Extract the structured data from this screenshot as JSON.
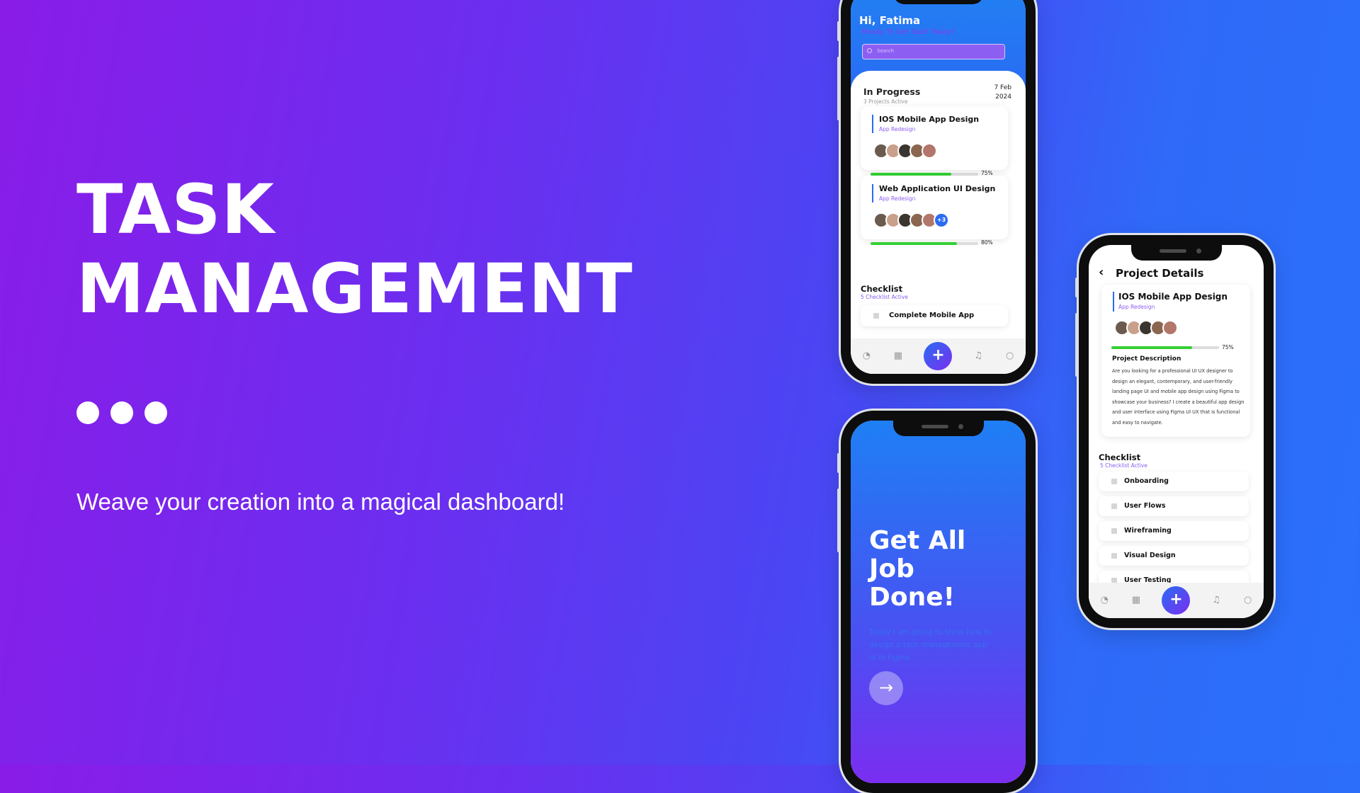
{
  "hero": {
    "title_line1": "TASK",
    "title_line2": "MANAGEMENT",
    "tagline": "Weave your creation into a magical dashboard!"
  },
  "colors": {
    "background_left": "#8a1ce8",
    "background_right": "#2a70fa",
    "accent_blue": "#2a6cf2",
    "accent_purple": "#8a5cf0",
    "progress_green": "#34d034"
  },
  "phone_home": {
    "greeting": "Hi, Fatima",
    "subtitle": "Ready To Get Start Today?",
    "search_placeholder": "Search",
    "section_title": "In Progress",
    "section_subtitle": "3 Projects Active",
    "date_line1": "7 Feb",
    "date_line2": "2024",
    "projects": [
      {
        "title": "IOS Mobile App Design",
        "subtitle": "App Redesign",
        "progress": 75,
        "progress_label": "75%",
        "extra_members": ""
      },
      {
        "title": "Web Application UI Design",
        "subtitle": "App Redesign",
        "progress": 80,
        "progress_label": "80%",
        "extra_members": "+3"
      }
    ],
    "checklist_title": "Checklist",
    "checklist_subtitle": "5 Checklist Active",
    "checklist_item": "Complete Mobile App",
    "nav": [
      "dashboard-icon",
      "calendar-icon",
      "add-icon",
      "bell-icon",
      "user-icon"
    ]
  },
  "phone_onboarding": {
    "headline_line1": "Get All",
    "headline_line2": "Job",
    "headline_line3": "Done!",
    "body": "Today I am going to show how to design a task management app ui in Figma",
    "next_icon": "arrow-right-icon"
  },
  "phone_details": {
    "title": "Project Details",
    "project_title": "IOS Mobile App Design",
    "project_subtitle": "App Redesign",
    "progress": 75,
    "progress_label": "75%",
    "description_title": "Project Description",
    "description": "Are you looking for a professional UI UX designer to design an elegant, contemporary, and user-friendly landing page UI and mobile app design using Figma to showcase your business? I create a beautiful app design and user interface using Figma UI UX that is functional and easy to navigate.",
    "checklist_title": "Checklist",
    "checklist_subtitle": "5 Checklist Active",
    "checklist": [
      "Onboarding",
      "User Flows",
      "Wireframing",
      "Visual Design",
      "User Testing"
    ]
  }
}
